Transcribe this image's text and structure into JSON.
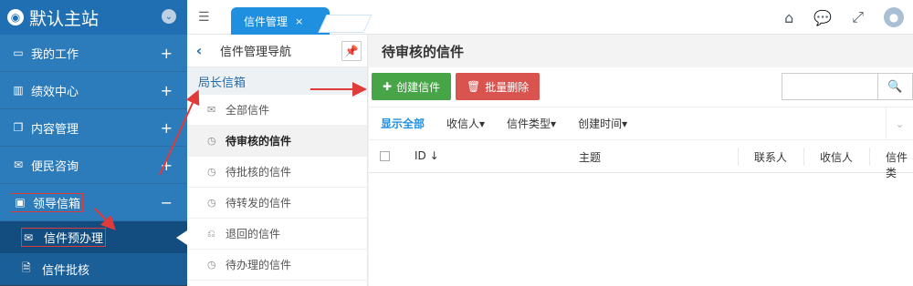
{
  "brand": {
    "title": "默认主站",
    "logo_icon": "globe-icon",
    "toggle_icon": "chevron-down-icon"
  },
  "sidebar": {
    "items": [
      {
        "label": "我的工作",
        "icon": "laptop-icon",
        "expander": "+"
      },
      {
        "label": "绩效中心",
        "icon": "bar-chart-icon",
        "expander": "+"
      },
      {
        "label": "内容管理",
        "icon": "copy-icon",
        "expander": "+"
      },
      {
        "label": "便民咨询",
        "icon": "envelope-icon",
        "expander": "+"
      },
      {
        "label": "领导信箱",
        "icon": "inbox-icon",
        "expander": "−"
      }
    ],
    "subitems": [
      {
        "label": "信件预办理",
        "icon": "mail-icon"
      },
      {
        "label": "信件批核",
        "icon": "file-check-icon"
      }
    ]
  },
  "topbar": {
    "tab_label": "信件管理",
    "tab_close": "×",
    "icons": [
      "home-icon",
      "chat-icon",
      "expand-icon",
      "user-avatar-icon"
    ]
  },
  "subnav": {
    "header": "信件管理导航",
    "group_title": "局长信箱",
    "items": [
      {
        "label": "全部信件",
        "icon": "envelope-outline-icon"
      },
      {
        "label": "待审核的信件",
        "icon": "clock-icon"
      },
      {
        "label": "待批核的信件",
        "icon": "clock-icon"
      },
      {
        "label": "待转发的信件",
        "icon": "clock-icon"
      },
      {
        "label": "退回的信件",
        "icon": "return-icon"
      },
      {
        "label": "待办理的信件",
        "icon": "clock-icon"
      }
    ]
  },
  "main": {
    "title": "待审核的信件",
    "buttons": {
      "create": "创建信件",
      "delete": "批量删除"
    },
    "search": {
      "placeholder": "",
      "icon": "search-icon"
    },
    "filters": [
      "显示全部",
      "收信人▾",
      "信件类型▾",
      "创建时间▾"
    ],
    "columns": {
      "id": "ID",
      "subject": "主题",
      "contact": "联系人",
      "recipient": "收信人",
      "type": "信件类"
    }
  },
  "colors": {
    "sidebar": "#2c7bbb",
    "accent": "#1f8fe0",
    "create": "#47a447",
    "delete": "#d9534f",
    "annotation": "#e03b3b"
  }
}
